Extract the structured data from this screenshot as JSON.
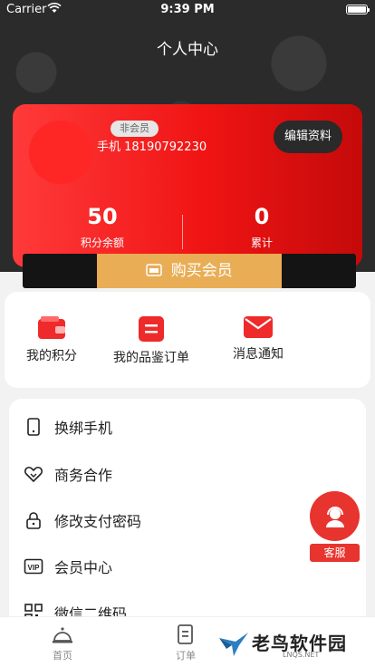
{
  "status_bar": {
    "carrier": "Carrier",
    "time": "9:39 PM"
  },
  "header": {
    "title": "个人中心"
  },
  "profile": {
    "badge": "非会员",
    "phone": "手机 18190792230",
    "edit_label": "编辑资料",
    "points_value": "50",
    "points_label": "积分余额",
    "total_value": "0",
    "total_label": "累计",
    "buy_label": "购买会员"
  },
  "quick_actions": [
    {
      "label": "我的积分",
      "icon": "wallet-icon"
    },
    {
      "label": "我的品鉴订单",
      "icon": "order-icon"
    },
    {
      "label": "消息通知",
      "icon": "mail-icon"
    }
  ],
  "menu": [
    {
      "label": "换绑手机",
      "icon": "phone-icon"
    },
    {
      "label": "商务合作",
      "icon": "handshake-icon"
    },
    {
      "label": "修改支付密码",
      "icon": "lock-icon"
    },
    {
      "label": "会员中心",
      "icon": "vip-icon"
    },
    {
      "label": "微信二维码",
      "icon": "qrcode-icon"
    }
  ],
  "service": {
    "label": "客服"
  },
  "tabs": [
    {
      "label": "首页",
      "icon": "bell-icon"
    },
    {
      "label": "订单",
      "icon": "order-icon"
    }
  ],
  "watermark": {
    "text": "老鸟软件园",
    "sub": "LNQS.NET"
  },
  "colors": {
    "accent": "#f01414",
    "gold": "#e9ad55",
    "dark": "#2b2b2b"
  }
}
